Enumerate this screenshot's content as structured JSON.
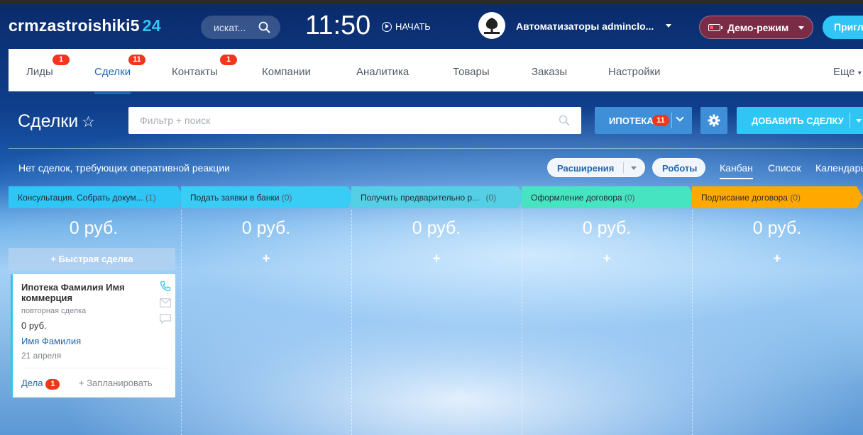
{
  "header": {
    "brand": "crmzastroishiki5",
    "brand_num": "24",
    "search_placeholder": "искат...",
    "clock": "11:50",
    "start_label": "НАЧАТЬ",
    "user_name": "Автоматизаторы adminclо...",
    "demo_label": "Демо-режим",
    "invite_label": "Пригл"
  },
  "nav": {
    "items": [
      {
        "label": "Лиды",
        "badge": "1"
      },
      {
        "label": "Сделки",
        "badge": "11"
      },
      {
        "label": "Контакты",
        "badge": "1"
      },
      {
        "label": "Компании",
        "badge": ""
      },
      {
        "label": "Аналитика",
        "badge": ""
      },
      {
        "label": "Товары",
        "badge": ""
      },
      {
        "label": "Заказы",
        "badge": ""
      },
      {
        "label": "Настройки",
        "badge": ""
      }
    ],
    "more": "Еще"
  },
  "toolbar": {
    "title": "Сделки",
    "filter_placeholder": "Фильтр + поиск",
    "pipeline_label": "ИПОТЕКА",
    "pipeline_badge": "11",
    "add_label": "ДОБАВИТЬ СДЕЛКУ"
  },
  "subbar": {
    "notice": "Нет сделок, требующих оперативной реакции",
    "extensions": "Расширения",
    "robots": "Роботы",
    "views": [
      "Канбан",
      "Список",
      "Календарь"
    ]
  },
  "stages": [
    {
      "name": "Консультация. Собрать докум...",
      "count": "(1)",
      "color": "#2fc6f6",
      "sum": "0 руб."
    },
    {
      "name": "Подать заявки в банки",
      "count": "(0)",
      "color": "#2fc6f6",
      "sum": "0 руб."
    },
    {
      "name": "Получить предварительно р...",
      "count": "(0)",
      "color": "#47c6e8",
      "sum": "0 руб."
    },
    {
      "name": "Оформление договора",
      "count": "(0)",
      "color": "#47e4c2",
      "sum": "0 руб."
    },
    {
      "name": "Подписание договора",
      "count": "(0)",
      "color": "#ffa900",
      "sum": "0 руб."
    }
  ],
  "quick_deal": "Быстрая сделка",
  "plus": "+",
  "card": {
    "title": "Ипотека Фамилия Имя коммерция",
    "subtitle": "повторная сделка",
    "sum": "0 руб.",
    "contact": "Имя Фамилия",
    "date": "21 апреля",
    "activities": "Дела",
    "activities_count": "1",
    "plan": "+ Запланировать"
  },
  "colors": {
    "accent": "#2fc6f6",
    "primary": "#3e8fd8",
    "badge": "#f0371b",
    "link": "#2067b0"
  }
}
